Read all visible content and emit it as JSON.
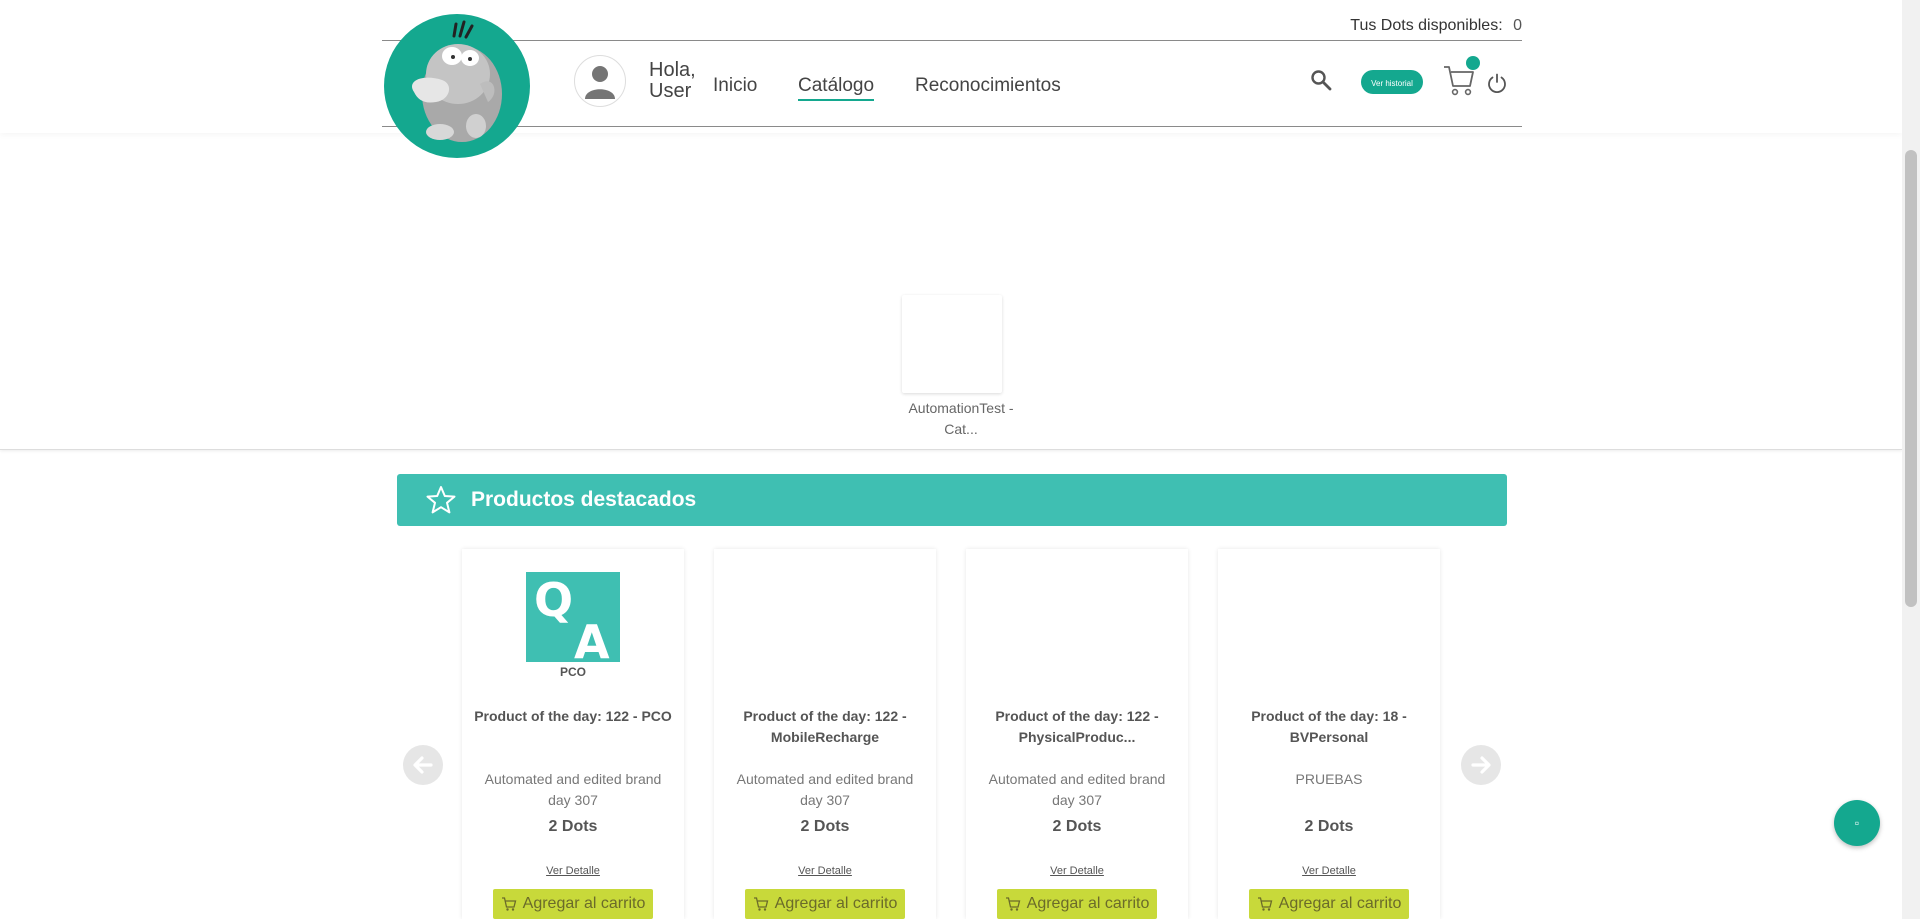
{
  "header": {
    "dots_label": "Tus Dots disponibles:",
    "dots_value": "0",
    "greeting_line1": "Hola,",
    "greeting_line2": "User",
    "nav": [
      {
        "label": "Inicio",
        "active": false
      },
      {
        "label": "Catálogo",
        "active": true
      },
      {
        "label": "Reconocimientos",
        "active": false
      }
    ],
    "history_button": "Ver historial",
    "icons": {
      "search": "search-icon",
      "cart": "cart-icon",
      "power": "power-icon",
      "avatar": "user-avatar-icon",
      "logo": "psyduck-logo"
    }
  },
  "category": {
    "label": "AutomationTest - Cat..."
  },
  "featured": {
    "title": "Productos destacados",
    "icon": "star-icon",
    "products": [
      {
        "image_label": "PCO",
        "image_text_top": "Q",
        "image_text_bottom": "A",
        "title": "Product of the day: 122 - PCO",
        "brand": "Automated and edited brand day 307",
        "price": "2 Dots",
        "detail": "Ver Detalle",
        "add": "Agregar al carrito"
      },
      {
        "image_label": "",
        "title": "Product of the day: 122 - MobileRecharge",
        "brand": "Automated and edited brand day 307",
        "price": "2 Dots",
        "detail": "Ver Detalle",
        "add": "Agregar al carrito"
      },
      {
        "image_label": "",
        "title": "Product of the day: 122 - PhysicalProduc...",
        "brand": "Automated and edited brand day 307",
        "price": "2 Dots",
        "detail": "Ver Detalle",
        "add": "Agregar al carrito"
      },
      {
        "image_label": "",
        "title": "Product of the day: 18 - BVPersonal",
        "brand": "PRUEBAS",
        "price": "2 Dots",
        "detail": "Ver Detalle",
        "add": "Agregar al carrito"
      }
    ]
  },
  "colors": {
    "brand": "#14a88f",
    "featured_bar": "#3fbfb2",
    "add_button": "#c8d93a"
  },
  "chat": {
    "icon": "chat-icon",
    "glyph": "▫"
  }
}
